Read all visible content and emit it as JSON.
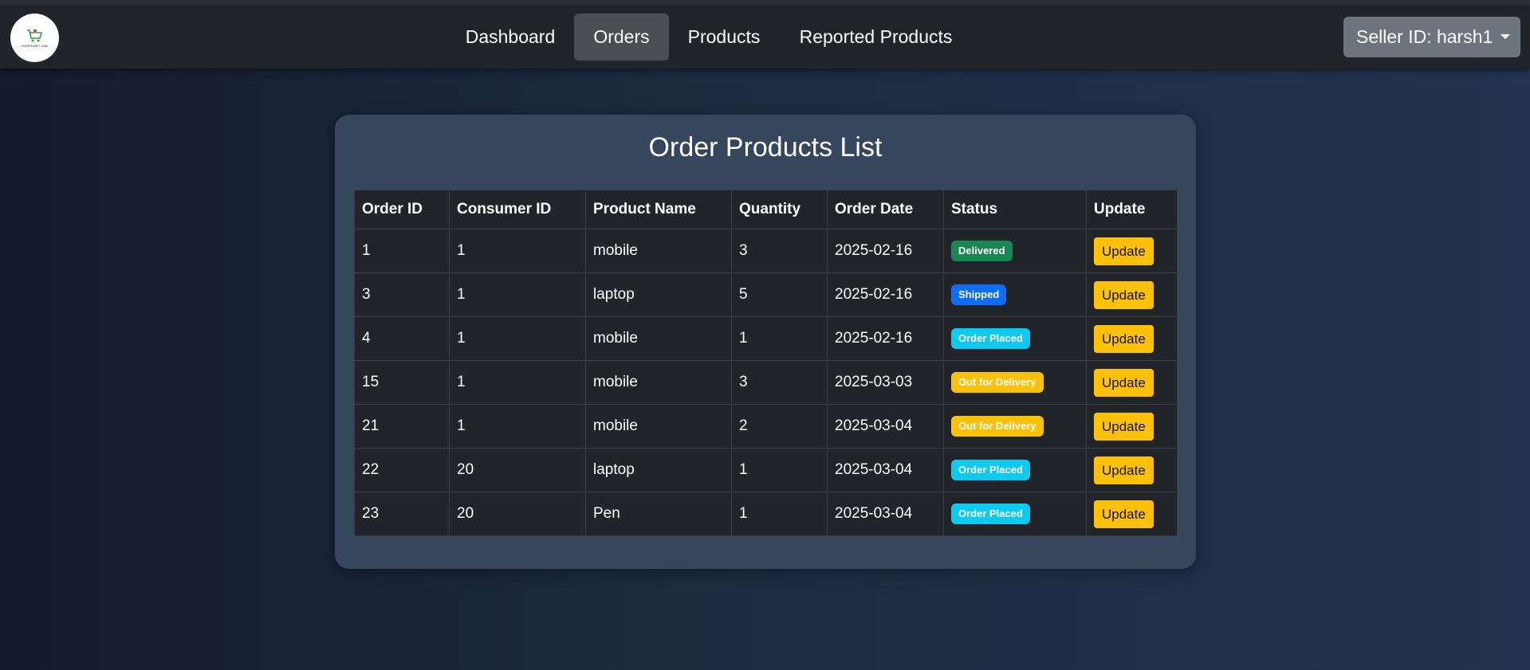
{
  "navbar": {
    "logo": {
      "icon": "shopping-cart-icon",
      "text": "SHOPKART LAB"
    },
    "links": [
      {
        "label": "Dashboard",
        "active": false
      },
      {
        "label": "Orders",
        "active": true
      },
      {
        "label": "Products",
        "active": false
      },
      {
        "label": "Reported Products",
        "active": false
      }
    ],
    "seller_label": "Seller ID: harsh1"
  },
  "main": {
    "title": "Order Products List",
    "columns": [
      "Order ID",
      "Consumer ID",
      "Product Name",
      "Quantity",
      "Order Date",
      "Status",
      "Update"
    ],
    "rows": [
      {
        "order_id": "1",
        "consumer_id": "1",
        "product": "mobile",
        "quantity": "3",
        "date": "2025-02-16",
        "status": "Delivered",
        "status_color": "#198754",
        "action": "Update"
      },
      {
        "order_id": "3",
        "consumer_id": "1",
        "product": "laptop",
        "quantity": "5",
        "date": "2025-02-16",
        "status": "Shipped",
        "status_color": "#0d6efd",
        "action": "Update"
      },
      {
        "order_id": "4",
        "consumer_id": "1",
        "product": "mobile",
        "quantity": "1",
        "date": "2025-02-16",
        "status": "Order Placed",
        "status_color": "#0dcaf0",
        "action": "Update"
      },
      {
        "order_id": "15",
        "consumer_id": "1",
        "product": "mobile",
        "quantity": "3",
        "date": "2025-03-03",
        "status": "Out for Delivery",
        "status_color": "#ffc107",
        "action": "Update"
      },
      {
        "order_id": "21",
        "consumer_id": "1",
        "product": "mobile",
        "quantity": "2",
        "date": "2025-03-04",
        "status": "Out for Delivery",
        "status_color": "#ffc107",
        "action": "Update"
      },
      {
        "order_id": "22",
        "consumer_id": "20",
        "product": "laptop",
        "quantity": "1",
        "date": "2025-03-04",
        "status": "Order Placed",
        "status_color": "#0dcaf0",
        "action": "Update"
      },
      {
        "order_id": "23",
        "consumer_id": "20",
        "product": "Pen",
        "quantity": "1",
        "date": "2025-03-04",
        "status": "Order Placed",
        "status_color": "#0dcaf0",
        "action": "Update"
      }
    ]
  },
  "colors": {
    "navbar_bg": "#212428",
    "card_bg": "#36465c",
    "table_bg": "#212529",
    "update_button": "#ffc107",
    "seller_button": "#6c757d"
  }
}
